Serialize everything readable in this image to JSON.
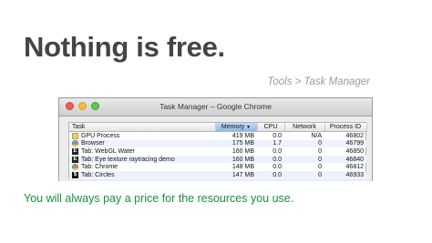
{
  "slide": {
    "title": "Nothing is free.",
    "breadcrumb": "Tools > Task Manager",
    "caption": "You will always pay a price for the resources you use."
  },
  "window": {
    "title": "Task Manager – Google Chrome"
  },
  "table": {
    "columns": [
      "Task",
      "Memory",
      "CPU",
      "Network",
      "Process ID"
    ],
    "sorted_column": "Memory",
    "rows": [
      {
        "icon": "puzzle-icon",
        "task": "GPU Process",
        "memory": "419 MB",
        "cpu": "0.0",
        "network": "N/A",
        "pid": "46802"
      },
      {
        "icon": "chrome-icon",
        "task": "Browser",
        "memory": "175 MB",
        "cpu": "1.7",
        "network": "0",
        "pid": "46799"
      },
      {
        "icon": "webgl-icon",
        "task": "Tab: WebGL Water",
        "memory": "160 MB",
        "cpu": "0.0",
        "network": "0",
        "pid": "46850"
      },
      {
        "icon": "webgl-icon",
        "task": "Tab: Eye texture raytracing demo",
        "memory": "160 MB",
        "cpu": "0.0",
        "network": "0",
        "pid": "46840"
      },
      {
        "icon": "chrome-icon",
        "task": "Tab: Chrome",
        "memory": "148 MB",
        "cpu": "0.0",
        "network": "0",
        "pid": "46812"
      },
      {
        "icon": "dollar-icon",
        "task": "Tab: Circles",
        "memory": "147 MB",
        "cpu": "0.0",
        "network": "0",
        "pid": "46933"
      }
    ]
  },
  "colors": {
    "title": "#444444",
    "caption": "#1a8f3c",
    "breadcrumb": "#9a9a9a",
    "sorted_header": "#8fb9e8"
  }
}
